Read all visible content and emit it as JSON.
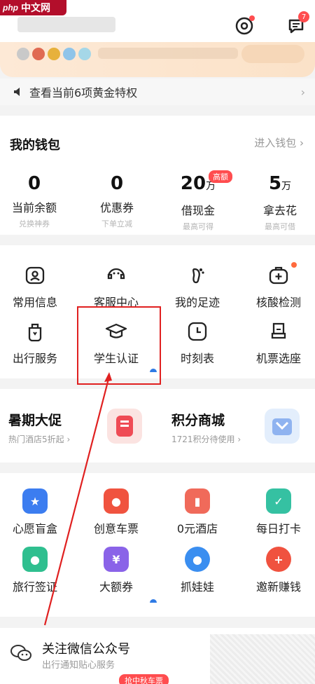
{
  "watermark": {
    "logo_prefix": "php",
    "logo_text": "中文网"
  },
  "header": {
    "message_badge": "7"
  },
  "gold": {
    "text": "查看当前6项黄金特权"
  },
  "wallet": {
    "title": "我的钱包",
    "link": "进入钱包",
    "items": [
      {
        "value": "0",
        "unit": "",
        "label": "当前余额",
        "sub": "兑换神券"
      },
      {
        "value": "0",
        "unit": "",
        "label": "优惠券",
        "sub": "下单立减"
      },
      {
        "value": "20",
        "unit": "万",
        "label": "借现金",
        "sub": "最高可得",
        "tag": "高额"
      },
      {
        "value": "5",
        "unit": "万",
        "label": "拿去花",
        "sub": "最高可借"
      }
    ]
  },
  "services": {
    "row1": [
      "常用信息",
      "客服中心",
      "我的足迹",
      "核酸检测"
    ],
    "row2": [
      "出行服务",
      "学生认证",
      "时刻表",
      "机票选座"
    ]
  },
  "promos": [
    {
      "title": "暑期大促",
      "sub": "热门酒店5折起"
    },
    {
      "title": "积分商城",
      "sub": "1721积分待使用"
    }
  ],
  "activities": {
    "row1": [
      "心愿盲盒",
      "创意车票",
      "0元酒店",
      "每日打卡"
    ],
    "row2": [
      "旅行签证",
      "大额券",
      "抓娃娃",
      "邀新赚钱"
    ]
  },
  "wechat": {
    "title": "关注微信公众号",
    "sub": "出行通知贴心服务",
    "tag": "抢中秋车票"
  },
  "colors": {
    "accent": "#2f7be5",
    "red": "#ff4d4f",
    "highlight": "#e02020"
  }
}
